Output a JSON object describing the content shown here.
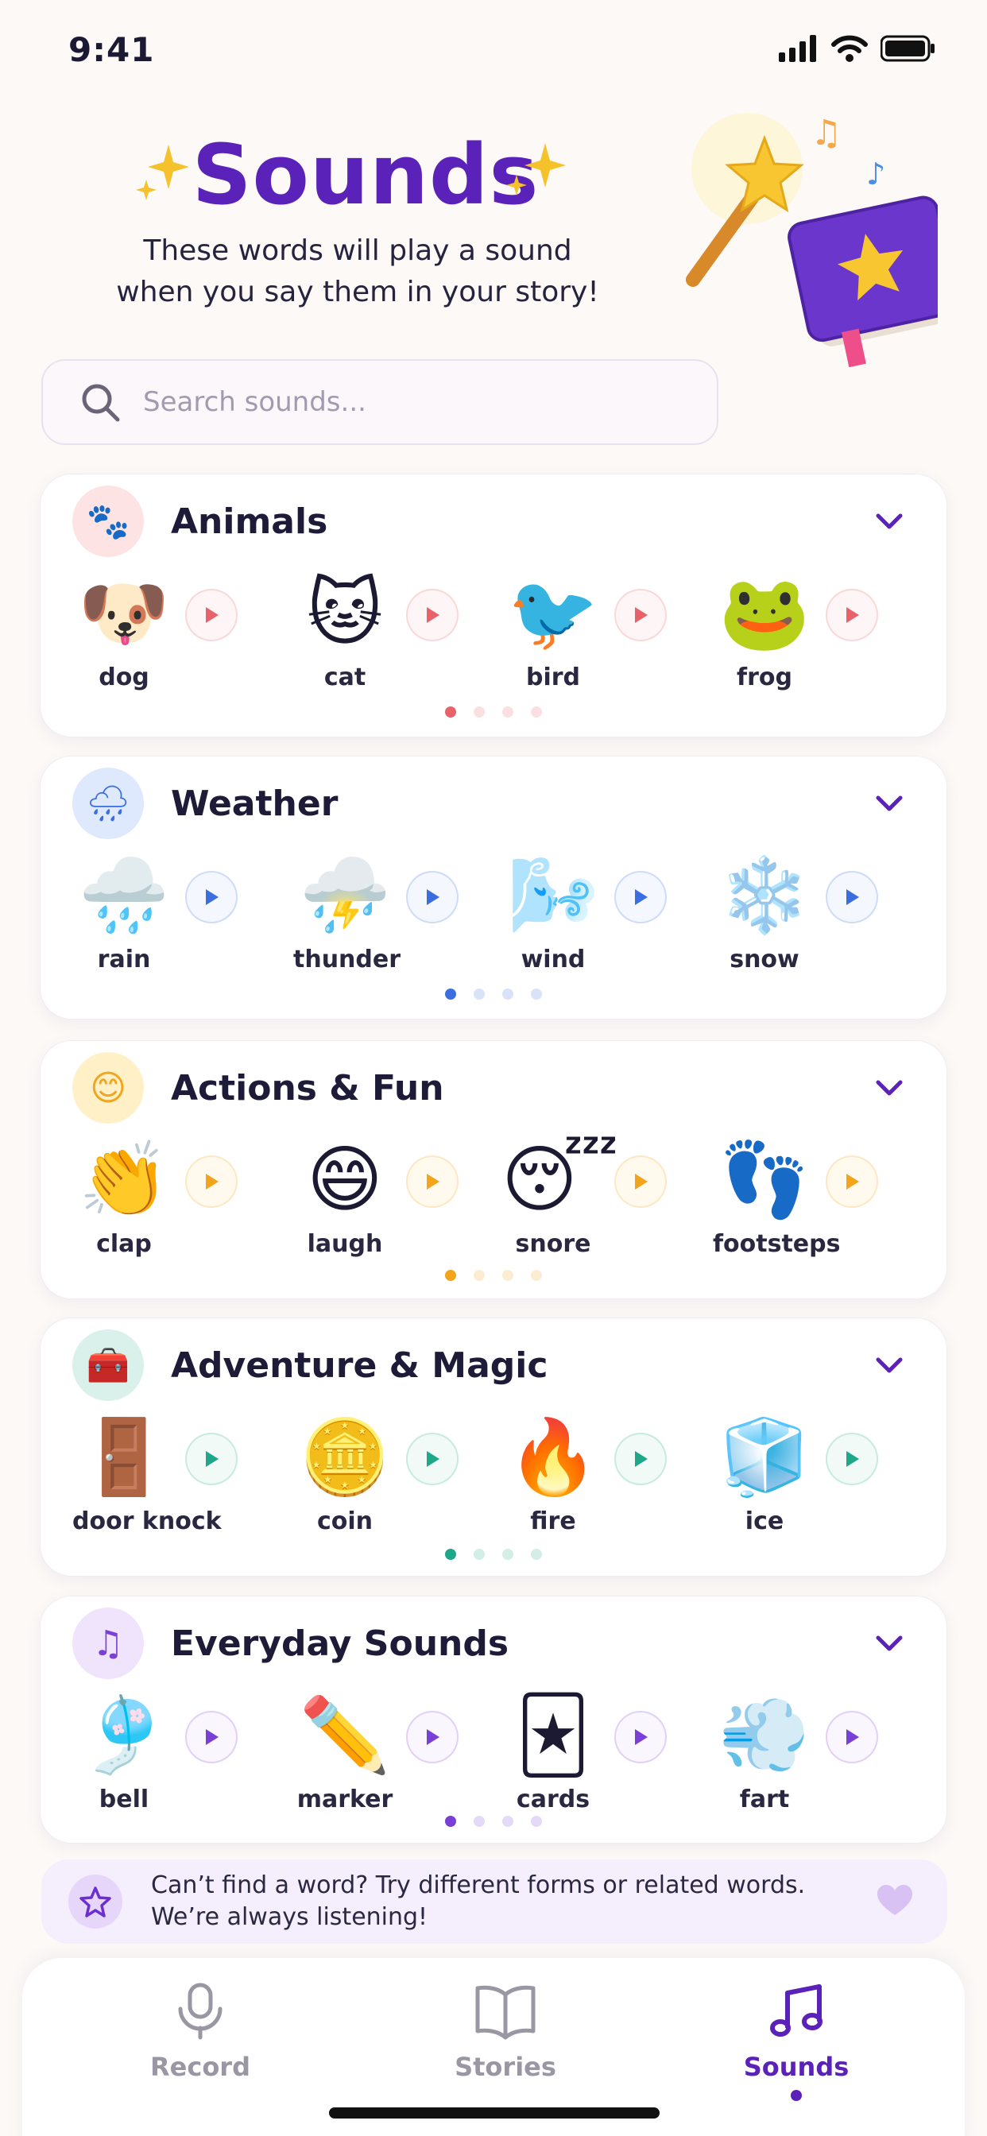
{
  "status": {
    "time": "9:41"
  },
  "header": {
    "title": "Sounds",
    "subtitle_line1": "These words will play a sound",
    "subtitle_line2": "when you say them in your story!"
  },
  "search": {
    "placeholder": "Search sounds..."
  },
  "categories": [
    {
      "title": "Animals",
      "icon": "paw-icon",
      "accent": "#e8626b",
      "icon_bg": "#fde3e3",
      "items": [
        {
          "word": "dog",
          "emoji": "🐶"
        },
        {
          "word": "cat",
          "emoji": "🐱"
        },
        {
          "word": "bird",
          "emoji": "🐦"
        },
        {
          "word": "frog",
          "emoji": "🐸"
        }
      ],
      "page": 1,
      "pages": 4
    },
    {
      "title": "Weather",
      "icon": "rain-cloud-icon",
      "accent": "#3b6fe0",
      "icon_bg": "#dfe9fd",
      "items": [
        {
          "word": "rain",
          "emoji": "🌧️"
        },
        {
          "word": "thunder",
          "emoji": "⛈️"
        },
        {
          "word": "wind",
          "emoji": "🌬️"
        },
        {
          "word": "snow",
          "emoji": "❄️"
        }
      ],
      "page": 1,
      "pages": 4
    },
    {
      "title": "Actions & Fun",
      "icon": "smile-icon",
      "accent": "#f2a41c",
      "icon_bg": "#fff0c8",
      "items": [
        {
          "word": "clap",
          "emoji": "👏"
        },
        {
          "word": "laugh",
          "emoji": "😄"
        },
        {
          "word": "snore",
          "emoji": "😴"
        },
        {
          "word": "footsteps",
          "emoji": "👣"
        }
      ],
      "page": 1,
      "pages": 4
    },
    {
      "title": "Adventure & Magic",
      "icon": "treasure-chest-icon",
      "accent": "#1ea889",
      "icon_bg": "#d9f1ea",
      "items": [
        {
          "word": "door knock",
          "emoji": "🚪"
        },
        {
          "word": "coin",
          "emoji": "🪙"
        },
        {
          "word": "fire",
          "emoji": "🔥"
        },
        {
          "word": "ice",
          "emoji": "🧊"
        }
      ],
      "page": 1,
      "pages": 4
    },
    {
      "title": "Everyday Sounds",
      "icon": "music-note-icon",
      "accent": "#7a3fd6",
      "icon_bg": "#efe4fc",
      "items": [
        {
          "word": "bell",
          "emoji": "🎐"
        },
        {
          "word": "marker",
          "emoji": "✏️"
        },
        {
          "word": "cards",
          "emoji": "🃏"
        },
        {
          "word": "fart",
          "emoji": "💨"
        }
      ],
      "page": 1,
      "pages": 4
    }
  ],
  "tip": {
    "line1": "Can’t find a word? Try different forms or related words.",
    "line2": "We’re always listening!"
  },
  "tabs": [
    {
      "label": "Record",
      "icon": "microphone-icon"
    },
    {
      "label": "Stories",
      "icon": "book-icon"
    },
    {
      "label": "Sounds",
      "icon": "music-note-icon",
      "active": true
    }
  ]
}
